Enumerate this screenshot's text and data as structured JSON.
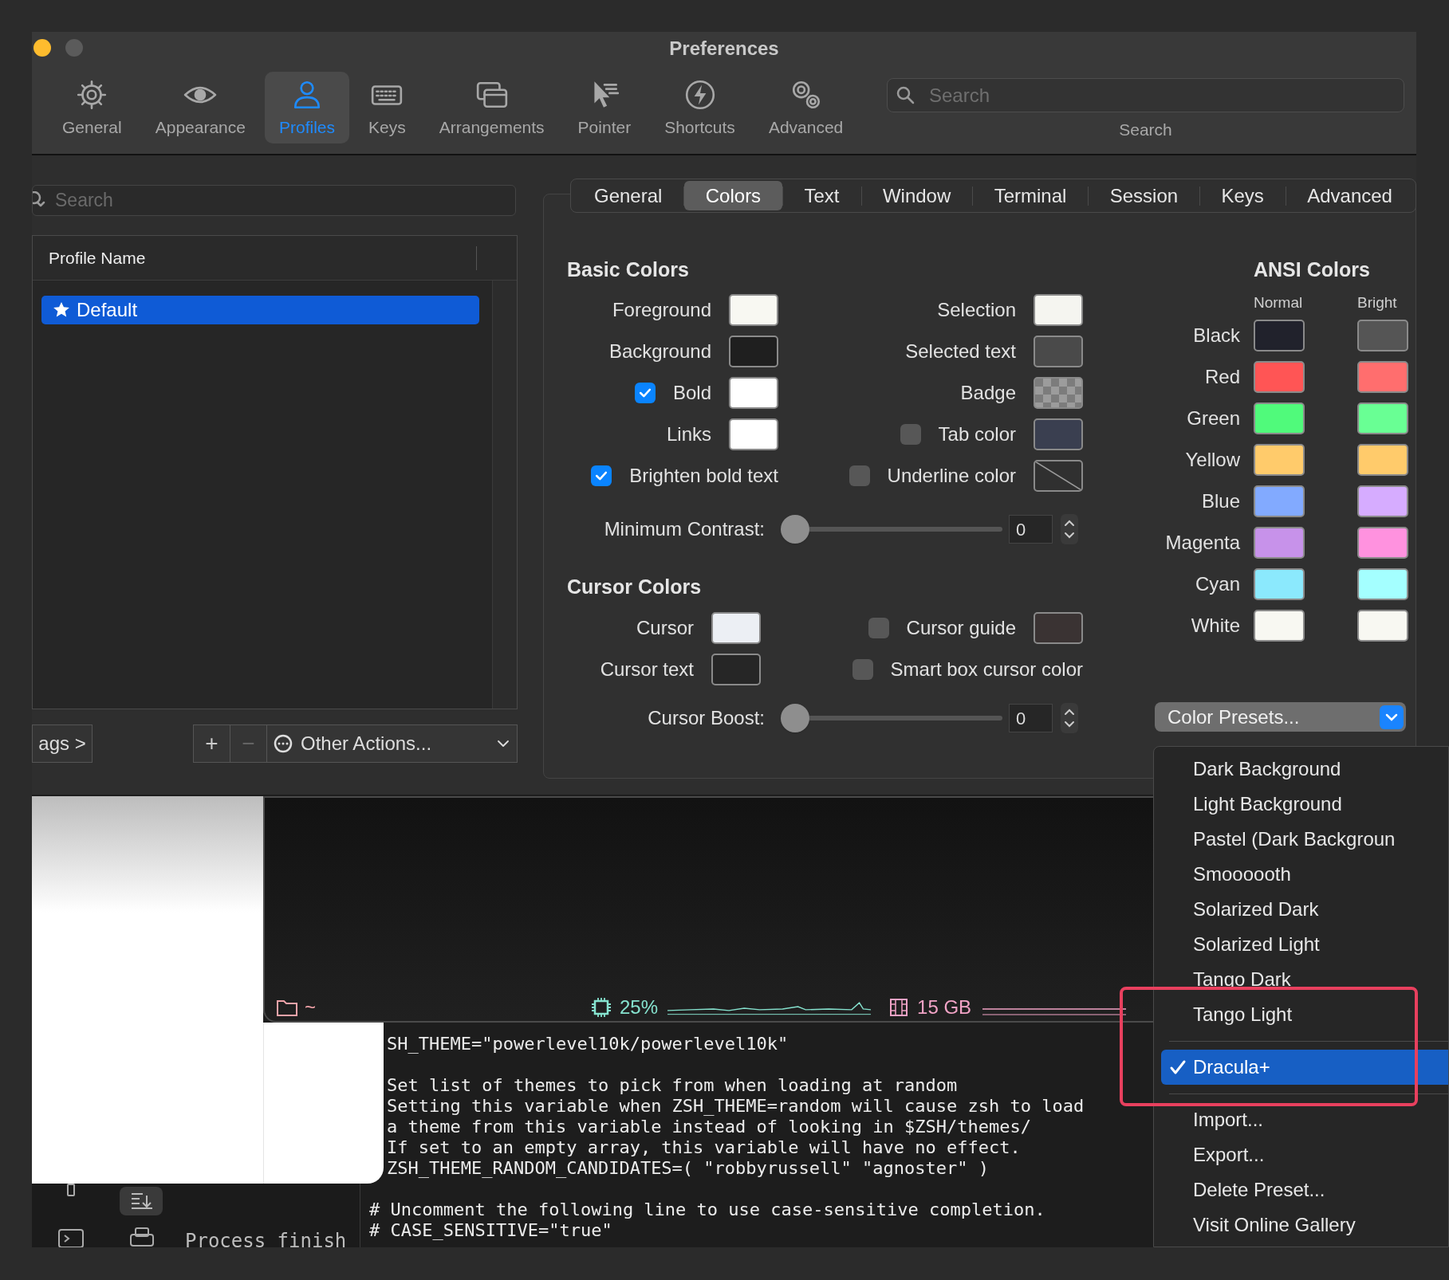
{
  "window": {
    "title": "Preferences",
    "traffic_lights": [
      {
        "color": "#febc2e"
      },
      {
        "color": "#5b5b5b"
      }
    ]
  },
  "toolbar": [
    {
      "label": "General",
      "selected": false
    },
    {
      "label": "Appearance",
      "selected": false
    },
    {
      "label": "Profiles",
      "selected": true
    },
    {
      "label": "Keys",
      "selected": false
    },
    {
      "label": "Arrangements",
      "selected": false
    },
    {
      "label": "Pointer",
      "selected": false
    },
    {
      "label": "Shortcuts",
      "selected": false
    },
    {
      "label": "Advanced",
      "selected": false
    }
  ],
  "search": {
    "placeholder": "Search",
    "label": "Search"
  },
  "profiles": {
    "search_placeholder": "Search",
    "column": "Profile Name",
    "rows": [
      {
        "name": "Default",
        "selected": true,
        "default": true
      }
    ]
  },
  "profile_buttons": {
    "tags": "ags >",
    "buttons": [
      {
        "label": "+",
        "disabled": false
      },
      {
        "label": "−",
        "disabled": true
      }
    ],
    "other_actions": "Other Actions..."
  },
  "tabs": [
    {
      "label": "General",
      "selected": false
    },
    {
      "label": "Colors",
      "selected": true
    },
    {
      "label": "Text",
      "selected": false
    },
    {
      "label": "Window",
      "selected": false
    },
    {
      "label": "Terminal",
      "selected": false
    },
    {
      "label": "Session",
      "selected": false
    },
    {
      "label": "Keys",
      "selected": false
    },
    {
      "label": "Advanced",
      "selected": false
    }
  ],
  "basic_colors": {
    "title": "Basic Colors",
    "rows": [
      {
        "left": {
          "kind": "swatch",
          "label": "Foreground",
          "color": "#f8f8f2"
        },
        "right": {
          "kind": "swatch",
          "label": "Selection",
          "color": "#f5f5f0"
        }
      },
      {
        "left": {
          "kind": "swatch",
          "label": "Background",
          "color": "#1f1f1f"
        },
        "right": {
          "kind": "swatch",
          "label": "Selected text",
          "color": "#4a4a4a"
        }
      },
      {
        "left": {
          "kind": "checkbox-swatch",
          "label": "Bold",
          "checked": true,
          "color": "#ffffff"
        },
        "right": {
          "kind": "checker-swatch",
          "label": "Badge"
        }
      },
      {
        "left": {
          "kind": "swatch",
          "label": "Links",
          "color": "#ffffff"
        },
        "right": {
          "kind": "checkbox-swatch",
          "label": "Tab color",
          "checked": false,
          "color": "#3a3f50"
        }
      },
      {
        "left": {
          "kind": "checkbox",
          "label": "Brighten bold text",
          "checked": true
        },
        "right": {
          "kind": "checkbox-empty-swatch",
          "label": "Underline color",
          "checked": false
        }
      }
    ],
    "slider": {
      "label": "Minimum Contrast:",
      "level": 0,
      "value": "0"
    }
  },
  "cursor_colors": {
    "title": "Cursor Colors",
    "rows": [
      {
        "left": {
          "kind": "swatch",
          "label": "Cursor",
          "color": "#eceff4"
        },
        "right": {
          "kind": "checkbox-swatch",
          "label": "Cursor guide",
          "checked": false,
          "color": "#3a3333"
        }
      },
      {
        "left": {
          "kind": "swatch",
          "label": "Cursor text",
          "color": "#262626"
        },
        "right": {
          "kind": "checkbox",
          "label": "Smart box cursor color",
          "checked": false
        }
      }
    ],
    "slider": {
      "label": "Cursor Boost:",
      "level": 0,
      "value": "0"
    }
  },
  "ansi_colors": {
    "title": "ANSI Colors",
    "columns": [
      "Normal",
      "Bright"
    ],
    "rows": [
      {
        "label": "Black",
        "normal": {
          "color": "#21222c"
        },
        "bright": {
          "color": "#555555"
        }
      },
      {
        "label": "Red",
        "normal": {
          "color": "#ff5555"
        },
        "bright": {
          "color": "#ff6e6e"
        }
      },
      {
        "label": "Green",
        "normal": {
          "color": "#50fa7b"
        },
        "bright": {
          "color": "#69ff94"
        }
      },
      {
        "label": "Yellow",
        "normal": {
          "color": "#ffcb6b"
        },
        "bright": {
          "color": "#ffcb6b"
        }
      },
      {
        "label": "Blue",
        "normal": {
          "color": "#82aaff"
        },
        "bright": {
          "color": "#d6acff"
        }
      },
      {
        "label": "Magenta",
        "normal": {
          "color": "#c792ea"
        },
        "bright": {
          "color": "#ff92df"
        }
      },
      {
        "label": "Cyan",
        "normal": {
          "color": "#8be9fd"
        },
        "bright": {
          "color": "#a4ffff"
        }
      },
      {
        "label": "White",
        "normal": {
          "color": "#f8f8f2"
        },
        "bright": {
          "color": "#f8f8f2"
        }
      }
    ]
  },
  "color_presets": {
    "label": "Color Presets...",
    "menu": [
      {
        "kind": "item",
        "label": "Dark Background",
        "selected": false
      },
      {
        "kind": "item",
        "label": "Light Background",
        "selected": false
      },
      {
        "kind": "item",
        "label": "Pastel (Dark Backgroun",
        "selected": false
      },
      {
        "kind": "item",
        "label": "Smoooooth",
        "selected": false
      },
      {
        "kind": "item",
        "label": "Solarized Dark",
        "selected": false
      },
      {
        "kind": "item",
        "label": "Solarized Light",
        "selected": false
      },
      {
        "kind": "item",
        "label": "Tango Dark",
        "selected": false
      },
      {
        "kind": "item",
        "label": "Tango Light",
        "selected": false
      },
      {
        "kind": "separator"
      },
      {
        "kind": "item",
        "label": "Dracula+",
        "selected": true
      },
      {
        "kind": "separator"
      },
      {
        "kind": "item",
        "label": "Import...",
        "selected": false
      },
      {
        "kind": "item",
        "label": "Export...",
        "selected": false
      },
      {
        "kind": "item",
        "label": "Delete Preset...",
        "selected": false
      },
      {
        "kind": "item",
        "label": "Visit Online Gallery",
        "selected": false
      }
    ]
  },
  "terminal": {
    "path": "~",
    "cpu": "25%",
    "memory": "15 GB",
    "upper_paragraphs": [
      [
        "SH_THEME=\"powerlevel10k/powerlevel10k\""
      ],
      [
        "Set list of themes to pick from when loading at random",
        "Setting this variable when ZSH_THEME=random will cause zsh to load",
        "a theme from this variable instead of looking in $ZSH/themes/",
        "If set to an empty array, this variable will have no effect.",
        "ZSH_THEME_RANDOM_CANDIDATES=( \"robbyrussell\" \"agnoster\" )"
      ]
    ],
    "lower_lines": [
      "# Uncomment the following line to use case-sensitive completion.",
      "# CASE_SENSITIVE=\"true\""
    ],
    "process_text": "Process finish"
  }
}
